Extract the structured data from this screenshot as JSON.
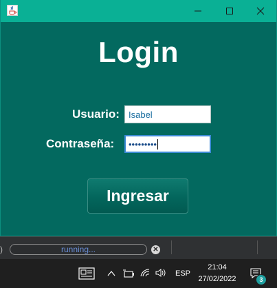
{
  "window": {
    "title_icon": "java-cup-icon",
    "controls": [
      "minimize-icon",
      "maximize-icon",
      "close-icon"
    ]
  },
  "login": {
    "title": "Login",
    "user_label": "Usuario:",
    "user_value": "Isabel",
    "pass_label": "Contraseña:",
    "pass_value": "•••••••••",
    "submit_label": "Ingresar"
  },
  "statusbar": {
    "prefix": ")",
    "progress_text": "running...",
    "cancel_icon": "cancel-icon"
  },
  "taskbar": {
    "language": "ESP",
    "time": "21:04",
    "date": "27/02/2022",
    "notification_count": "3"
  },
  "colors": {
    "window_bg": "#03695f",
    "titlebar_bg": "#0ab095",
    "text": "#ffffff",
    "taskbar_bg": "#1f1f1f"
  }
}
